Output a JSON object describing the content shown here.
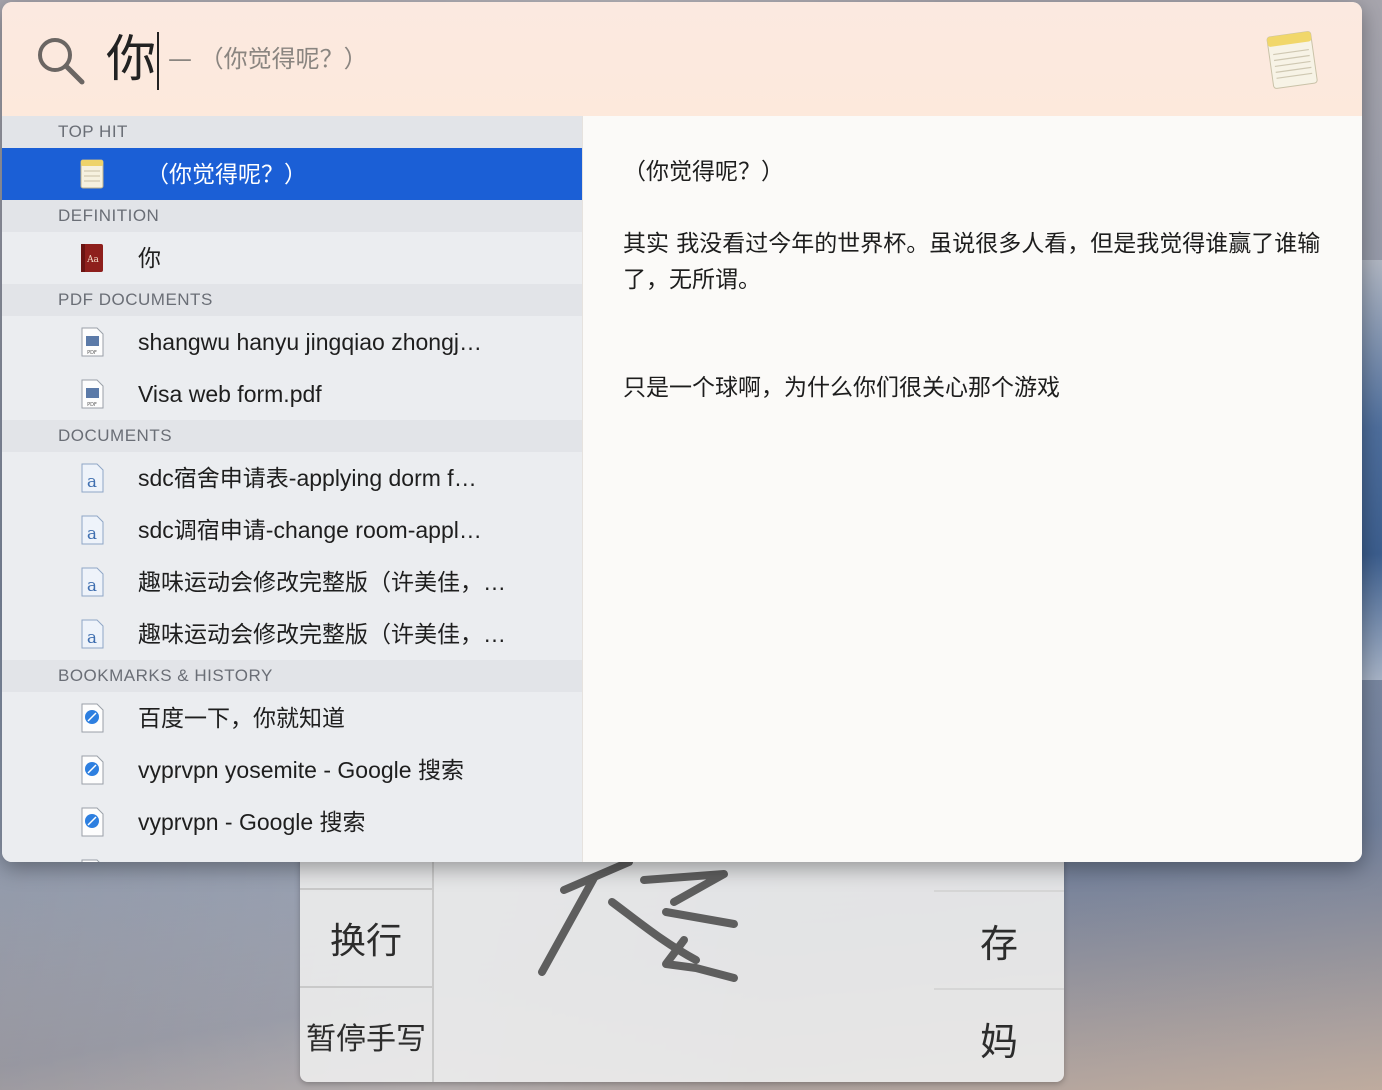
{
  "search": {
    "query": "你",
    "suggestion": "— （你觉得呢？）"
  },
  "sections": [
    {
      "header": "TOP HIT",
      "items": [
        {
          "label": "（你觉得呢？）",
          "icon": "notes-icon",
          "selected": true
        }
      ]
    },
    {
      "header": "DEFINITION",
      "items": [
        {
          "label": "你",
          "icon": "dictionary-icon"
        }
      ]
    },
    {
      "header": "PDF DOCUMENTS",
      "items": [
        {
          "label": "shangwu hanyu jingqiao zhongj…",
          "icon": "pdf-icon"
        },
        {
          "label": "Visa web form.pdf",
          "icon": "pdf-icon"
        }
      ]
    },
    {
      "header": "DOCUMENTS",
      "items": [
        {
          "label": "sdc宿舍申请表-applying dorm f…",
          "icon": "document-icon"
        },
        {
          "label": "sdc调宿申请-change room-appl…",
          "icon": "document-icon"
        },
        {
          "label": "趣味运动会修改完整版（许美佳，…",
          "icon": "document-icon"
        },
        {
          "label": "趣味运动会修改完整版（许美佳，…",
          "icon": "document-icon"
        }
      ]
    },
    {
      "header": "BOOKMARKS & HISTORY",
      "items": [
        {
          "label": "百度一下，你就知道",
          "icon": "webloc-icon"
        },
        {
          "label": "vyprvpn yosemite - Google 搜索",
          "icon": "webloc-icon"
        },
        {
          "label": "vyprvpn - Google 搜索",
          "icon": "webloc-icon"
        }
      ]
    }
  ],
  "preview": {
    "title": "（你觉得呢？）",
    "paragraph1": "其实 我没看过今年的世界杯。虽说很多人看，但是我觉得谁赢了谁输了，无所谓。",
    "paragraph2": "只是一个球啊，为什么你们很关心那个游戏"
  },
  "handwriting": {
    "newline_key": "换行",
    "pause_key": "暂停手写",
    "candidates": [
      "存",
      "妈"
    ]
  },
  "colors": {
    "selection": "#1b5fd6",
    "search_bar_bg": "#fde9dc"
  }
}
